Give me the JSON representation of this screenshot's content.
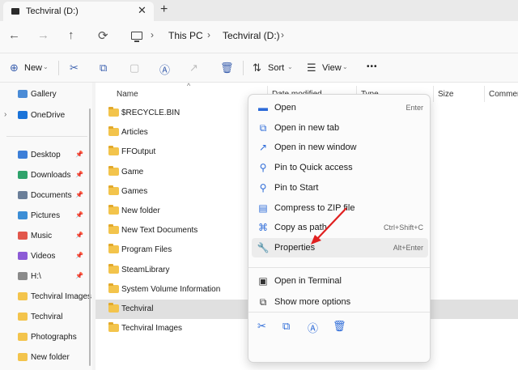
{
  "tab": {
    "title": "Techviral (D:)",
    "close": "✕",
    "new": "+"
  },
  "nav": {
    "back": "←",
    "forward": "→",
    "up": "↑",
    "refresh": "⟳"
  },
  "breadcrumb": {
    "sep": "›",
    "items": [
      "This PC",
      "Techviral (D:)"
    ]
  },
  "toolbar": {
    "new_label": "New",
    "sort_label": "Sort",
    "view_label": "View",
    "more": "•••"
  },
  "sidebar": {
    "top": [
      {
        "label": "Gallery",
        "icon": "gallery-icon",
        "color": "#4a8bd6"
      },
      {
        "label": "OneDrive",
        "icon": "onedrive-icon",
        "color": "#1a73d9"
      }
    ],
    "items": [
      {
        "label": "Desktop",
        "icon": "desktop-icon",
        "color": "#3d7fd8"
      },
      {
        "label": "Downloads",
        "icon": "downloads-icon",
        "color": "#2fa36b"
      },
      {
        "label": "Documents",
        "icon": "documents-icon",
        "color": "#6b7f99"
      },
      {
        "label": "Pictures",
        "icon": "pictures-icon",
        "color": "#3b8ed6"
      },
      {
        "label": "Music",
        "icon": "music-icon",
        "color": "#e2574c"
      },
      {
        "label": "Videos",
        "icon": "videos-icon",
        "color": "#8c5bd6"
      },
      {
        "label": "H:\\",
        "icon": "drive-icon",
        "color": "#8a8a8a"
      },
      {
        "label": "Techviral Images",
        "icon": "folder-icon",
        "color": "#f3c44c"
      },
      {
        "label": "Techviral",
        "icon": "folder-icon",
        "color": "#f3c44c"
      },
      {
        "label": "Photographs",
        "icon": "folder-icon",
        "color": "#f3c44c"
      },
      {
        "label": "New folder",
        "icon": "folder-icon",
        "color": "#f3c44c"
      }
    ]
  },
  "columns": [
    "Name",
    "Date modified",
    "Type",
    "Size",
    "Commer"
  ],
  "files": [
    "$RECYCLE.BIN",
    "Articles",
    "FFOutput",
    "Game",
    "Games",
    "New folder",
    "New Text Documents",
    "Program Files",
    "SteamLibrary",
    "System Volume Information",
    "Techviral",
    "Techviral Images"
  ],
  "selected_file": "Techviral",
  "context_menu": {
    "items": [
      {
        "label": "Open",
        "shortcut": "Enter",
        "icon": "open-icon"
      },
      {
        "label": "Open in new tab",
        "shortcut": "",
        "icon": "new-tab-icon"
      },
      {
        "label": "Open in new window",
        "shortcut": "",
        "icon": "new-window-icon"
      },
      {
        "label": "Pin to Quick access",
        "shortcut": "",
        "icon": "pin-icon"
      },
      {
        "label": "Pin to Start",
        "shortcut": "",
        "icon": "pin-start-icon"
      },
      {
        "label": "Compress to ZIP file",
        "shortcut": "",
        "icon": "zip-icon"
      },
      {
        "label": "Copy as path",
        "shortcut": "Ctrl+Shift+C",
        "icon": "copy-path-icon"
      },
      {
        "label": "Properties",
        "shortcut": "Alt+Enter",
        "icon": "wrench-icon"
      }
    ],
    "extra": [
      {
        "label": "Open in Terminal",
        "icon": "terminal-icon"
      },
      {
        "label": "Show more options",
        "icon": "more-options-icon"
      }
    ],
    "highlighted": "Properties"
  },
  "colors": {
    "accent": "#2d6bd8",
    "folder": "#f3c44c",
    "selection": "#e0e0e0",
    "annotation_arrow": "#e02020"
  }
}
